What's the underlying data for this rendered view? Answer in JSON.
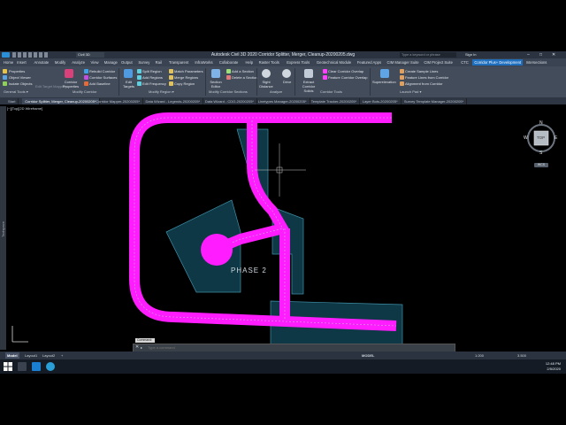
{
  "app": {
    "title": "Autodesk Civil 3D 2020   Corridor Splitter, Merger, Cleanup-20200205.dwg",
    "workspace": "Civil 3D",
    "search_placeholder": "Type a keyword or phrase",
    "signin": "Sign In"
  },
  "ribbon_tabs": [
    "Home",
    "Insert",
    "Annotate",
    "Modify",
    "Analyze",
    "View",
    "Manage",
    "Output",
    "Survey",
    "Rail",
    "Transparent",
    "InfraWorks",
    "Collaborate",
    "Help",
    "Raster Tools",
    "Express Tools",
    "Geotechnical Module",
    "Featured Apps",
    "CIM Manager Suite",
    "CIM Project Suite",
    "CTC",
    "Corridor Plus+ Development",
    "Intersections"
  ],
  "active_tab": "Corridor Plus+ Development",
  "ribbon": {
    "general_tools": [
      "Properties",
      "Object Viewer",
      "Isolate Objects"
    ],
    "corridor_main": [
      "Corridor Properties"
    ],
    "group_dim": "Edit Target Mapping",
    "modify_corridor": [
      "Rebuild Corridor",
      "Corridor Surfaces",
      "Add Baseline"
    ],
    "edit_targets": "Edit Targets",
    "region_cmds": [
      "Split Region",
      "Add Regions",
      "Edit Frequency"
    ],
    "region_cmds2": [
      "Match Parameters",
      "Merge Regions",
      "Copy Region"
    ],
    "section_editor": "Section Editor",
    "section_cmds": [
      "Add a Section",
      "Delete a Section"
    ],
    "analyze_cmds": [
      "Sight Distance",
      "Drive"
    ],
    "extract": "Extract Corridor Solids",
    "corridor_tools": [
      "Clear Corridor Overlap",
      "Feature Corridor Overlap"
    ],
    "superelevation": "Superelevation",
    "launchpad": [
      "Create Sample Lines",
      "Feature Lines from Corridor",
      "Alignment from Corridor"
    ],
    "groups": [
      "General Tools ▾",
      "Modify Corridor",
      "Modify Region ▾",
      "Modify Corridor Sections",
      "Analyze",
      "Corridor Tools",
      "Launch Pad ▾"
    ]
  },
  "doc_tabs": [
    "Start",
    "Corridor Splitter, Merger, Cleanup-20200205*",
    "Corridor Mapper-20200205*",
    "Data Wizard - Legends-20200205*",
    "Data Wizard - CDO-20200205*",
    "Linetypes Manager-20200205*",
    "Template Tracker-20200205*",
    "Layer Bots-20200205*",
    "Survey Template Manager-20200205*"
  ],
  "active_doc": 1,
  "viewport_label": "[−][Top][2D Wireframe]",
  "drawing": {
    "phase_label": "PHASE 2",
    "viewcube": {
      "top": "TOP",
      "n": "N",
      "s": "S",
      "e": "E",
      "w": "W",
      "wcs": "WCS"
    },
    "corridor_color": "#ff1cff",
    "boundary_color": "#0e3845"
  },
  "tool_palette_label": "Toolspace",
  "command": {
    "history": "Command: ",
    "placeholder": "Type a command"
  },
  "layout_tabs": [
    "Model",
    "Layout1",
    "Layout2"
  ],
  "active_layout": "Model",
  "status": {
    "model": "MODEL",
    "scale": "1:200",
    "precision": "3.500"
  },
  "taskbar": {
    "time": "12:48 PM",
    "date": "2/5/2020"
  }
}
